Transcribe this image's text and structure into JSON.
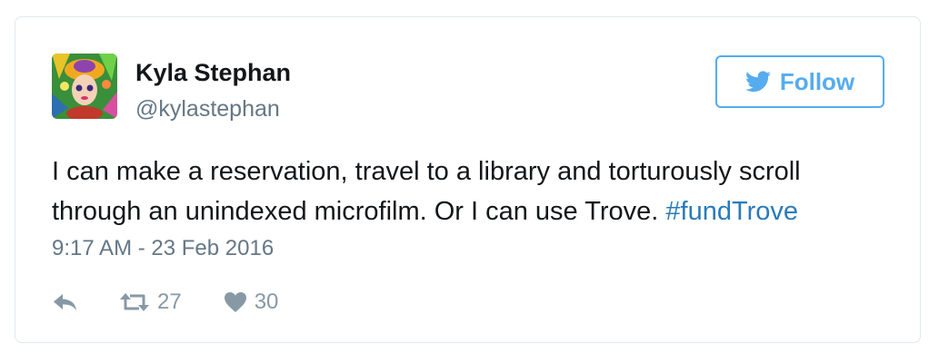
{
  "author": {
    "name": "Kyla Stephan",
    "handle": "@kylastephan"
  },
  "follow_button": {
    "label": "Follow",
    "icon": "twitter-bird-icon"
  },
  "tweet": {
    "text": "I can make a reservation, travel to a library and torturously scroll through an unindexed microfilm. Or I can use Trove.",
    "hashtag": "#fundTrove",
    "timestamp": "9:17 AM - 23 Feb 2016"
  },
  "actions": {
    "reply_icon": "reply-icon",
    "retweet_icon": "retweet-icon",
    "retweet_count": "27",
    "like_icon": "heart-icon",
    "like_count": "30"
  },
  "colors": {
    "accent": "#55acee",
    "link": "#2b7bb9",
    "text": "#14171a",
    "muted": "#657786",
    "icon_gray": "#8899a6",
    "border": "#e1e8ed"
  }
}
